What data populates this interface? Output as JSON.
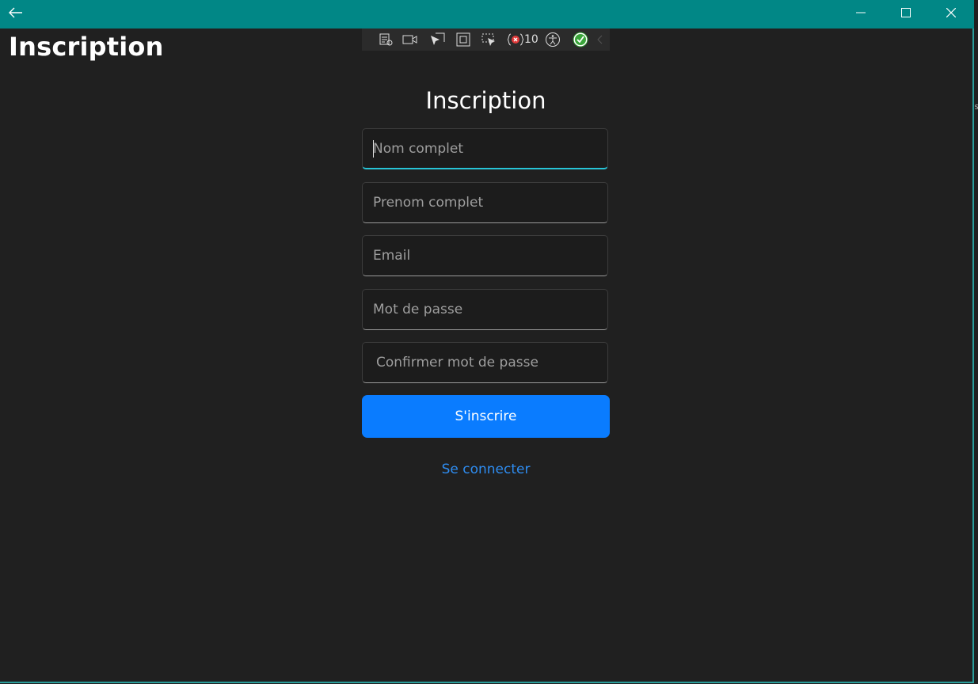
{
  "header": {
    "title": "Inscription"
  },
  "debug_toolbar": {
    "icons": [
      "live-visual-tree-icon",
      "record-icon",
      "select-element-icon",
      "display-layout-adorners-icon",
      "track-focus-icon",
      "binding-failures-icon",
      "accessibility-checker-icon",
      "hot-reload-ok-icon",
      "collapse-toolbar-icon"
    ],
    "binding_failure_count": "10"
  },
  "form": {
    "title": "Inscription",
    "fields": [
      {
        "placeholder": "Nom complet",
        "value": ""
      },
      {
        "placeholder": "Prenom complet",
        "value": ""
      },
      {
        "placeholder": "Email",
        "value": ""
      },
      {
        "placeholder": "Mot de passe",
        "value": ""
      },
      {
        "placeholder": "Confirmer mot de passe",
        "value": ""
      }
    ],
    "submit_label": "S'inscrire",
    "login_link": "Se connecter"
  },
  "colors": {
    "titlebar": "#018786",
    "background": "#202020",
    "accent_button": "#0a7cff",
    "link": "#2e8cf0",
    "focus_underline": "#27c4d6"
  }
}
